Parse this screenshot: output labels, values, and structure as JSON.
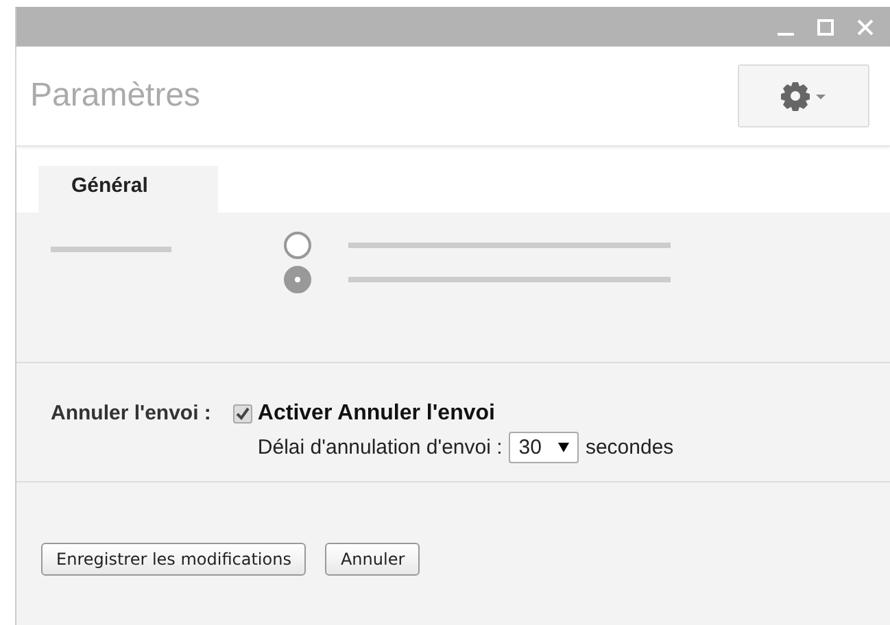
{
  "window": {
    "title": "Paramètres"
  },
  "tabs": [
    {
      "label": "Général",
      "selected": true
    }
  ],
  "placeholder_options": [
    {
      "selected": false
    },
    {
      "selected": true
    }
  ],
  "undo_send": {
    "label": "Annuler l'envoi :",
    "checkbox": {
      "label": "Activer Annuler l'envoi",
      "checked": true
    },
    "delay_label": "Délai d'annulation d'envoi :",
    "delay_value": "30",
    "unit": "secondes"
  },
  "buttons": [
    "Enregistrer les modifications",
    "Annuler"
  ]
}
